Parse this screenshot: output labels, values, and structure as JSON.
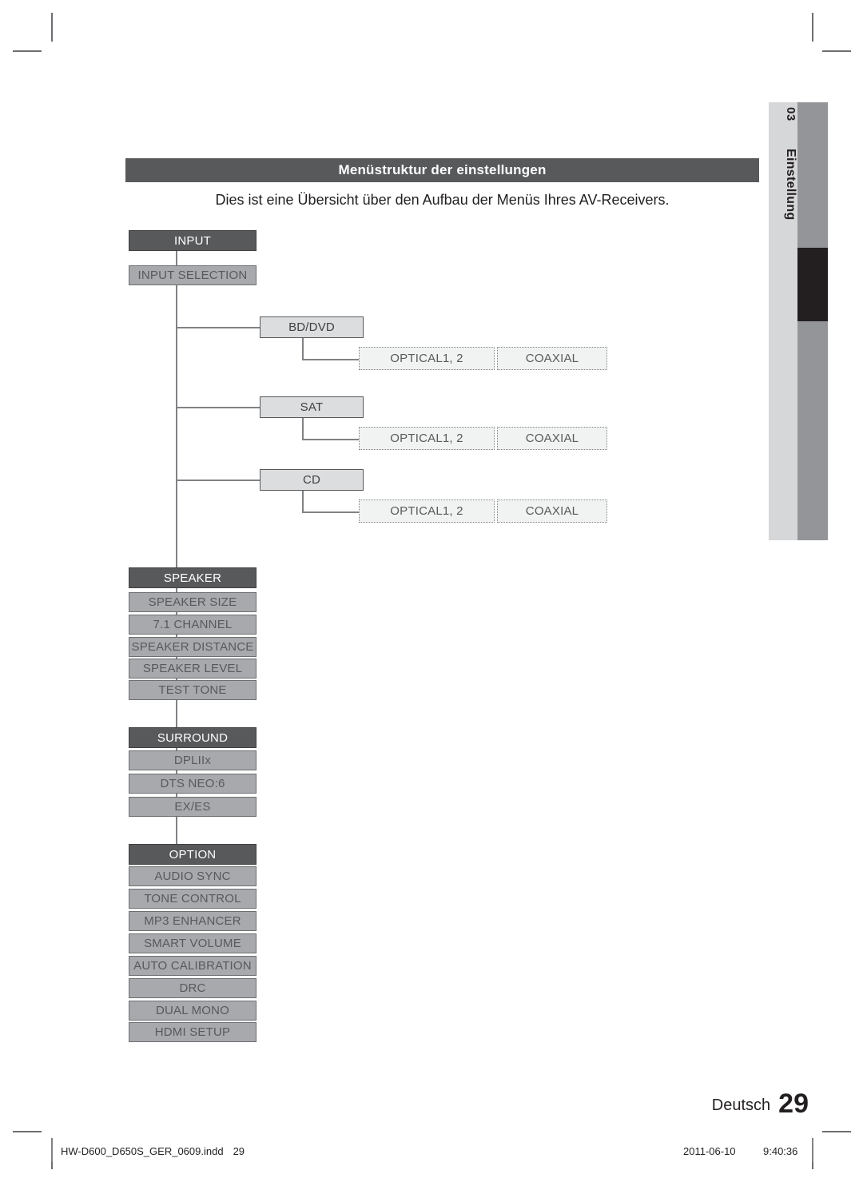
{
  "page": {
    "chapter_number": "03",
    "chapter_label": "Einstellung",
    "title": "Menüstruktur der einstellungen",
    "subtitle": "Dies ist eine Übersicht über den Aufbau der Menüs Ihres AV-Receivers.",
    "language": "Deutsch",
    "page_number": "29"
  },
  "footer": {
    "file_name": "HW-D600_D650S_GER_0609.indd",
    "file_page": "29",
    "date": "2011-06-10",
    "time": "9:40:36"
  },
  "colors": {
    "header_fill": "#58595b",
    "child_fill": "#a7a9ac",
    "solid_fill": "#dcddde",
    "dotted_fill": "#f1f2f2",
    "line": "#808285",
    "tab_light": "#d6d7d8",
    "tab_gray": "#939598",
    "tab_active": "#231f20"
  },
  "diagram": {
    "sections": [
      {
        "id": "input",
        "header": "INPUT",
        "selection": "INPUT SELECTION",
        "sources": [
          {
            "label": "BD/DVD",
            "leaves": [
              "OPTICAL1, 2",
              "COAXIAL"
            ]
          },
          {
            "label": "SAT",
            "leaves": [
              "OPTICAL1, 2",
              "COAXIAL"
            ]
          },
          {
            "label": "CD",
            "leaves": [
              "OPTICAL1, 2",
              "COAXIAL"
            ]
          }
        ]
      },
      {
        "id": "speaker",
        "header": "SPEAKER",
        "items": [
          "SPEAKER SIZE",
          "7.1 CHANNEL",
          "SPEAKER DISTANCE",
          "SPEAKER LEVEL",
          "TEST TONE"
        ]
      },
      {
        "id": "surround",
        "header": "SURROUND",
        "items": [
          "DPLIIx",
          "DTS NEO:6",
          "EX/ES"
        ]
      },
      {
        "id": "option",
        "header": "OPTION",
        "items": [
          "AUDIO SYNC",
          "TONE CONTROL",
          "MP3 ENHANCER",
          "SMART VOLUME",
          "AUTO CALIBRATION",
          "DRC",
          "DUAL MONO",
          "HDMI SETUP"
        ]
      }
    ]
  }
}
